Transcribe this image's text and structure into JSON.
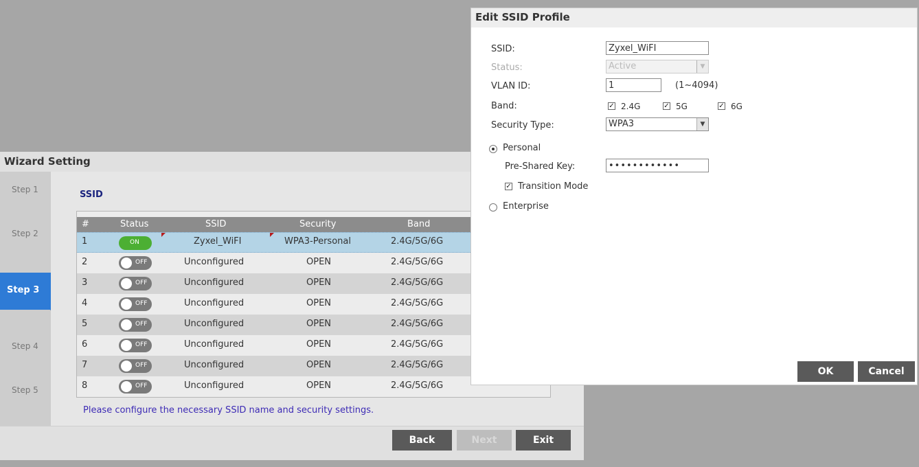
{
  "wizard": {
    "title": "Wizard Setting",
    "steps": [
      "Step 1",
      "Step 2",
      "Step 3",
      "Step 4",
      "Step 5"
    ],
    "active_step": "Step 3",
    "section_title": "SSID",
    "columns": [
      "#",
      "Status",
      "SSID",
      "Security",
      "Band"
    ],
    "rows": [
      {
        "num": "1",
        "status": "ON",
        "ssid": "Zyxel_WiFI",
        "security": "WPA3-Personal",
        "band": "2.4G/5G/6G"
      },
      {
        "num": "2",
        "status": "OFF",
        "ssid": "Unconfigured",
        "security": "OPEN",
        "band": "2.4G/5G/6G"
      },
      {
        "num": "3",
        "status": "OFF",
        "ssid": "Unconfigured",
        "security": "OPEN",
        "band": "2.4G/5G/6G"
      },
      {
        "num": "4",
        "status": "OFF",
        "ssid": "Unconfigured",
        "security": "OPEN",
        "band": "2.4G/5G/6G"
      },
      {
        "num": "5",
        "status": "OFF",
        "ssid": "Unconfigured",
        "security": "OPEN",
        "band": "2.4G/5G/6G"
      },
      {
        "num": "6",
        "status": "OFF",
        "ssid": "Unconfigured",
        "security": "OPEN",
        "band": "2.4G/5G/6G"
      },
      {
        "num": "7",
        "status": "OFF",
        "ssid": "Unconfigured",
        "security": "OPEN",
        "band": "2.4G/5G/6G"
      },
      {
        "num": "8",
        "status": "OFF",
        "ssid": "Unconfigured",
        "security": "OPEN",
        "band": "2.4G/5G/6G"
      }
    ],
    "hint": "Please configure the necessary SSID name and security settings.",
    "buttons": {
      "back": "Back",
      "next": "Next",
      "exit": "Exit"
    }
  },
  "dialog": {
    "title": "Edit SSID Profile",
    "ssid_label": "SSID:",
    "ssid_value": "Zyxel_WiFI",
    "status_label": "Status:",
    "status_value": "Active",
    "vlan_label": "VLAN ID:",
    "vlan_value": "1",
    "vlan_range": "(1~4094)",
    "band_label": "Band:",
    "bands": [
      "2.4G",
      "5G",
      "6G"
    ],
    "security_label": "Security Type:",
    "security_value": "WPA3",
    "personal_label": "Personal",
    "psk_label": "Pre-Shared Key:",
    "psk_value": "••••••••••••",
    "transition_label": "Transition Mode",
    "enterprise_label": "Enterprise",
    "ok": "OK",
    "cancel": "Cancel"
  },
  "colors": {
    "active_step": "#2e7bd6",
    "toggle_on": "#4caf33",
    "toggle_off": "#7a7a7a",
    "selected_row": "#b4d4e6",
    "hint_text": "#3d2bb5",
    "button": "#5a5a5a"
  }
}
